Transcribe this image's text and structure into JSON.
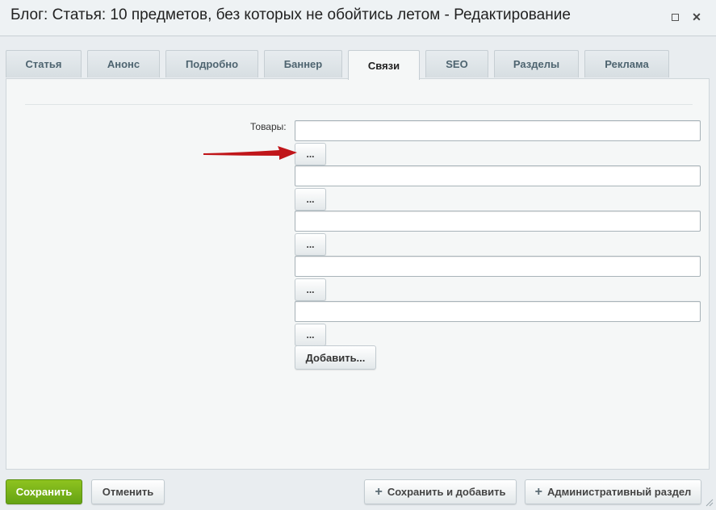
{
  "window": {
    "title": "Блог: Статья: 10 предметов, без которых не обойтись летом - Редактирование",
    "maximize_icon": "maximize-icon",
    "close_icon": "close-icon",
    "close_glyph": "✕"
  },
  "tabs": [
    {
      "label": "Статья",
      "active": false
    },
    {
      "label": "Анонс",
      "active": false
    },
    {
      "label": "Подробно",
      "active": false
    },
    {
      "label": "Баннер",
      "active": false
    },
    {
      "label": "Связи",
      "active": true
    },
    {
      "label": "SEO",
      "active": false
    },
    {
      "label": "Разделы",
      "active": false
    },
    {
      "label": "Реклама",
      "active": false
    }
  ],
  "form": {
    "products_label": "Товары:",
    "inputs": [
      {
        "value": "",
        "browse_label": "..."
      },
      {
        "value": "",
        "browse_label": "..."
      },
      {
        "value": "",
        "browse_label": "..."
      },
      {
        "value": "",
        "browse_label": "..."
      },
      {
        "value": "",
        "browse_label": "..."
      }
    ],
    "add_label": "Добавить..."
  },
  "annotation": {
    "arrow_color": "#c0161a",
    "icon": "red-arrow-icon"
  },
  "footer": {
    "save_label": "Сохранить",
    "cancel_label": "Отменить",
    "save_add_label": "Сохранить и добавить",
    "admin_label": "Административный раздел",
    "plus_glyph": "+",
    "save_color": "#79b31b"
  }
}
